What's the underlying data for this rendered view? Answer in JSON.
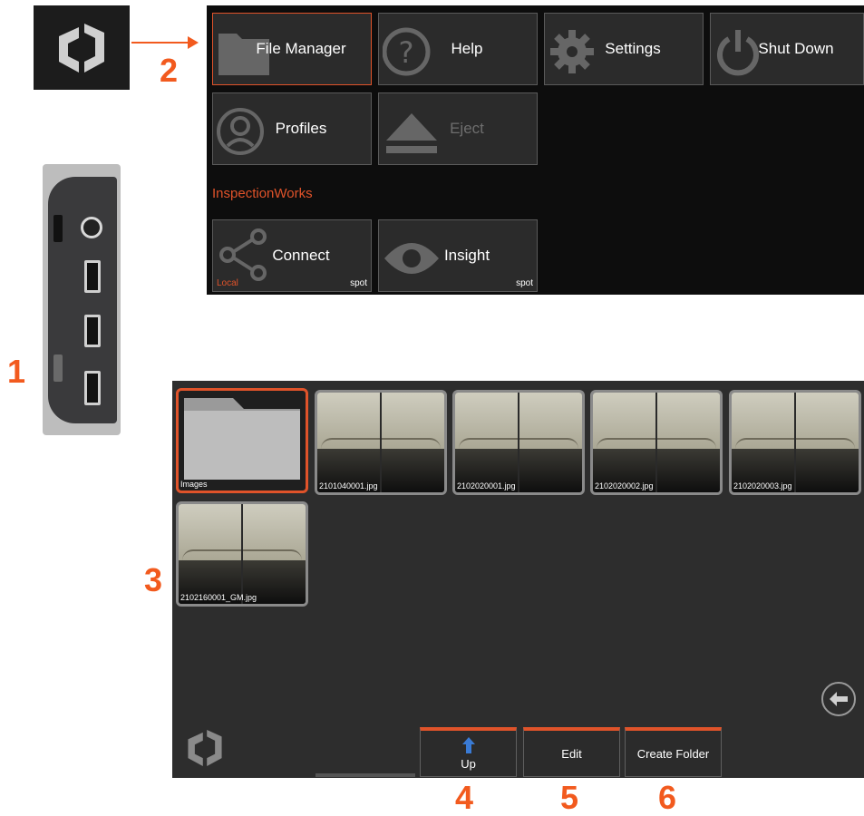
{
  "callouts": [
    "1",
    "2",
    "3",
    "4",
    "5",
    "6"
  ],
  "menu": {
    "tiles": [
      {
        "label": "File Manager",
        "icon": "folder-icon"
      },
      {
        "label": "Help",
        "icon": "question-icon"
      },
      {
        "label": "Settings",
        "icon": "gear-icon"
      },
      {
        "label": "Shut Down",
        "icon": "power-icon"
      },
      {
        "label": "Profiles",
        "icon": "user-icon"
      },
      {
        "label": "Eject",
        "icon": "eject-icon"
      }
    ],
    "section_label": "InspectionWorks",
    "iw_tiles": [
      {
        "label": "Connect",
        "icon": "share-icon",
        "tag_left": "Local",
        "tag_right": "spot"
      },
      {
        "label": "Insight",
        "icon": "eye-icon",
        "tag_right": "spot"
      }
    ]
  },
  "file_manager": {
    "items": [
      {
        "name": "Images",
        "type": "folder"
      },
      {
        "name": "2101040001.jpg",
        "type": "image"
      },
      {
        "name": "2102020001.jpg",
        "type": "image"
      },
      {
        "name": "2102020002.jpg",
        "type": "image"
      },
      {
        "name": "2102020003.jpg",
        "type": "image"
      },
      {
        "name": "2102160001_GM.jpg",
        "type": "image"
      }
    ],
    "buttons": {
      "up": "Up",
      "edit": "Edit",
      "create_folder": "Create Folder"
    }
  },
  "colors": {
    "accent": "#e0532a",
    "callout": "#f25a1e",
    "up_arrow": "#3a7bd5"
  }
}
